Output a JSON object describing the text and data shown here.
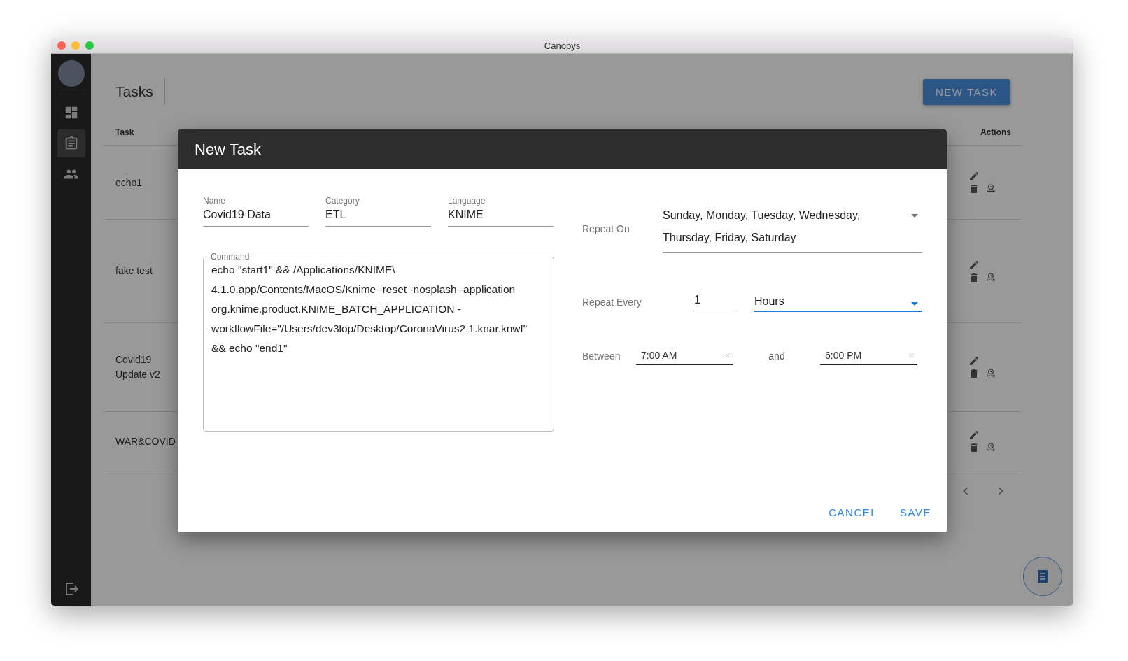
{
  "window": {
    "title": "Canopys"
  },
  "sidebar": {
    "items": [
      {
        "kind": "dashboard",
        "selected": false
      },
      {
        "kind": "tasks",
        "selected": true
      },
      {
        "kind": "users",
        "selected": false
      }
    ]
  },
  "page": {
    "title": "Tasks",
    "new_button": "NEW TASK"
  },
  "table": {
    "columns": [
      {
        "label": "Task",
        "kind": "task"
      },
      {
        "label": "Actions",
        "kind": "actions"
      }
    ],
    "rows": [
      {
        "task": "echo1"
      },
      {
        "task": "fake test"
      },
      {
        "task": "Covid19 Update v2"
      },
      {
        "task": "WAR&COVID"
      }
    ]
  },
  "dialog": {
    "title": "New Task",
    "fields": [
      {
        "label": "Name",
        "value": "Covid19 Data"
      },
      {
        "label": "Category",
        "value": "ETL"
      },
      {
        "label": "Language",
        "value": "KNIME"
      }
    ],
    "command": {
      "label": "Command",
      "value": "echo \"start1\" && /Applications/KNIME\\ 4.1.0.app/Contents/MacOS/Knime -reset -nosplash -application org.knime.product.KNIME_BATCH_APPLICATION -workflowFile=\"/Users/dev3lop/Desktop/CoronaVirus2.1.knar.knwf\" && echo \"end1\""
    },
    "repeat_on": {
      "label": "Repeat On",
      "value": "Sunday, Monday, Tuesday, Wednesday, Thursday, Friday, Saturday"
    },
    "repeat_every": {
      "label": "Repeat Every",
      "count": "1",
      "unit": "Hours",
      "focused": true
    },
    "between": {
      "label": "Between",
      "start": "7:00 AM",
      "joiner": "and",
      "end": "6:00 PM"
    },
    "buttons": [
      {
        "label": "CANCEL"
      },
      {
        "label": "SAVE"
      }
    ]
  }
}
